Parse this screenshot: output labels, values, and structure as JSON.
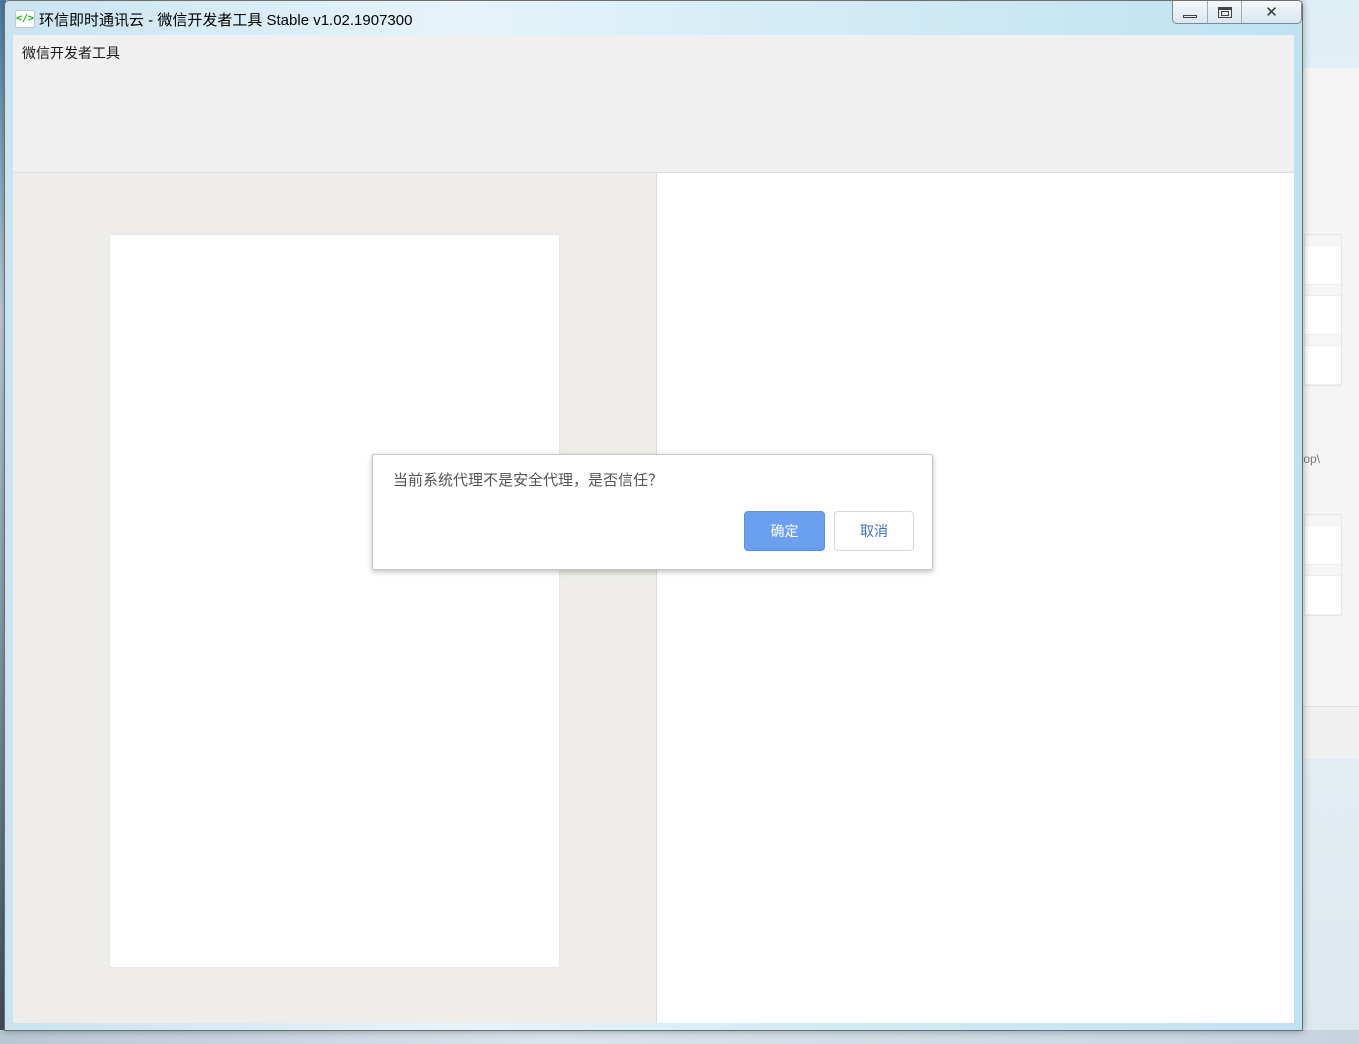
{
  "window": {
    "title": "环信即时通讯云 - 微信开发者工具 Stable v1.02.1907300",
    "icon": "wechat-devtools-icon",
    "icon_glyph": "</>",
    "controls": {
      "minimize": "minimize-icon",
      "maximize": "maximize-icon",
      "close": "close-icon",
      "close_glyph": "✕"
    }
  },
  "toolbar": {
    "title": "微信开发者工具"
  },
  "dialog": {
    "message": "当前系统代理不是安全代理，是否信任？",
    "confirm_label": "确定",
    "cancel_label": "取消"
  },
  "background": {
    "partial_text": "ktop\\"
  },
  "colors": {
    "confirm_button": "#6b9ff0",
    "cancel_text": "#3b6fc4",
    "toolbar_bg": "#f0f0f0",
    "simulator_bg": "#eeedea"
  }
}
